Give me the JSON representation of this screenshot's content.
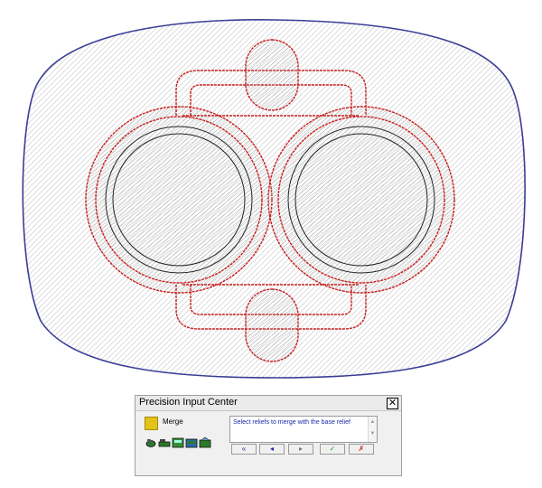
{
  "panel": {
    "title": "Precision Input Center",
    "close_glyph": "✕",
    "merge_label": "Merge",
    "message": "Select reliefs to merge with the base relief",
    "tool_icons": [
      "relief-tool-1-icon",
      "relief-tool-2-icon",
      "relief-tool-3-icon",
      "relief-tool-4-icon",
      "relief-tool-5-icon"
    ],
    "buttons": {
      "first": "«",
      "previous": "◂",
      "next": "▸",
      "ok": "✓",
      "cancel": "✗"
    }
  },
  "colors": {
    "boundary": "#3b3d96",
    "relief_outline": "#c81e1e",
    "circles": "#222222",
    "hatch": "#b8b8b8",
    "merge_swatch": "#e3c21a",
    "message_text": "#1a2aa8",
    "ok": "#1a9a1a",
    "cancel": "#c81e1e",
    "nav_arrows": "#1a2aa8"
  }
}
